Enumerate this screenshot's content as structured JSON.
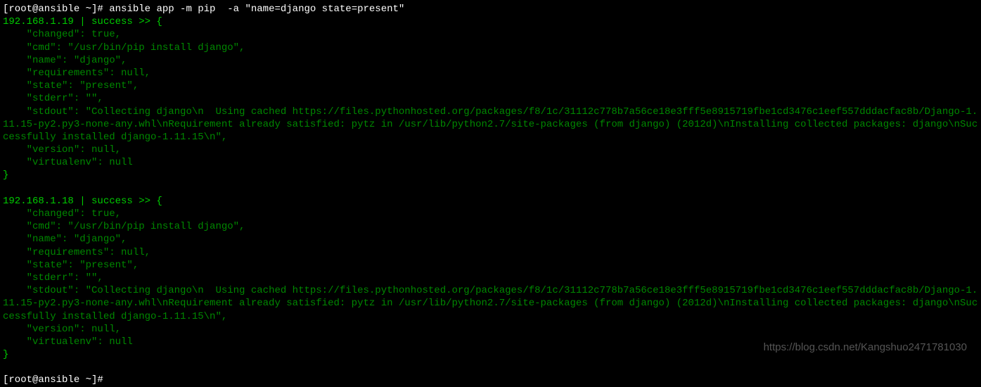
{
  "prompt1": "[root@ansible ~]# ",
  "command": "ansible app -m pip  -a \"name=django state=present\"",
  "host1": {
    "header": "192.168.1.19 | success >> {",
    "changed": "    \"changed\": true,",
    "cmd": "    \"cmd\": \"/usr/bin/pip install django\",",
    "name": "    \"name\": \"django\",",
    "requirements": "    \"requirements\": null,",
    "state": "    \"state\": \"present\",",
    "stderr": "    \"stderr\": \"\",",
    "stdout": "    \"stdout\": \"Collecting django\\n  Using cached https://files.pythonhosted.org/packages/f8/1c/31112c778b7a56ce18e3fff5e8915719fbe1cd3476c1eef557dddacfac8b/Django-1.11.15-py2.py3-none-any.whl\\nRequirement already satisfied: pytz in /usr/lib/python2.7/site-packages (from django) (2012d)\\nInstalling collected packages: django\\nSuccessfully installed django-1.11.15\\n\",",
    "version": "    \"version\": null,",
    "virtualenv": "    \"virtualenv\": null",
    "close": "}"
  },
  "host2": {
    "header": "192.168.1.18 | success >> {",
    "changed": "    \"changed\": true,",
    "cmd": "    \"cmd\": \"/usr/bin/pip install django\",",
    "name": "    \"name\": \"django\",",
    "requirements": "    \"requirements\": null,",
    "state": "    \"state\": \"present\",",
    "stderr": "    \"stderr\": \"\",",
    "stdout": "    \"stdout\": \"Collecting django\\n  Using cached https://files.pythonhosted.org/packages/f8/1c/31112c778b7a56ce18e3fff5e8915719fbe1cd3476c1eef557dddacfac8b/Django-1.11.15-py2.py3-none-any.whl\\nRequirement already satisfied: pytz in /usr/lib/python2.7/site-packages (from django) (2012d)\\nInstalling collected packages: django\\nSuccessfully installed django-1.11.15\\n\",",
    "version": "    \"version\": null,",
    "virtualenv": "    \"virtualenv\": null",
    "close": "}"
  },
  "prompt2": "[root@ansible ~]#",
  "watermark": "https://blog.csdn.net/Kangshuo2471781030"
}
